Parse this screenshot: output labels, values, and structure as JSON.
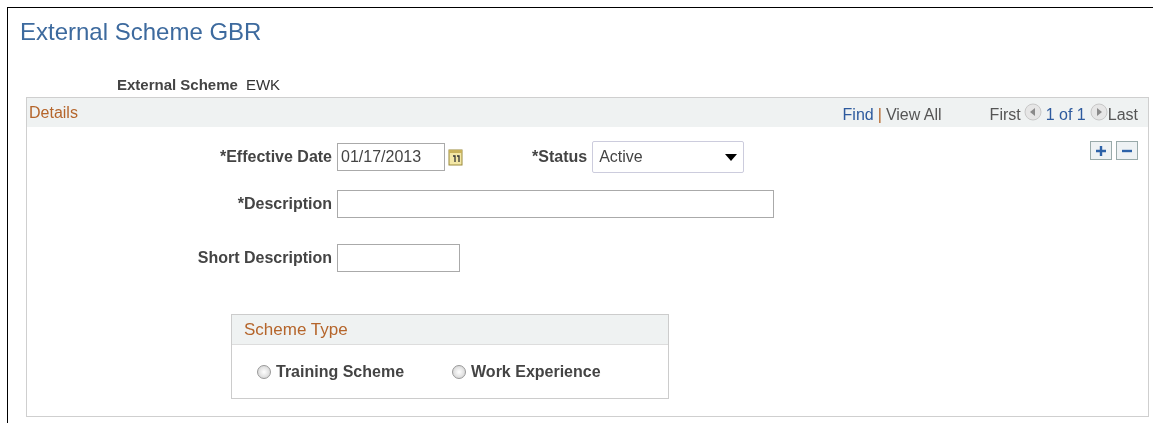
{
  "page_title": "External Scheme GBR",
  "key_field": {
    "label": "External Scheme",
    "value": "EWK"
  },
  "details": {
    "title": "Details",
    "nav": {
      "find": "Find",
      "separator": "|",
      "view_all": "View All",
      "first": "First",
      "counter": "1 of 1",
      "last": "Last"
    },
    "effective_date": {
      "label": "*Effective Date",
      "value": "01/17/2013"
    },
    "status": {
      "label": "*Status",
      "value": "Active"
    },
    "description": {
      "label": "*Description"
    },
    "short_description": {
      "label": "Short Description"
    },
    "scheme_type": {
      "title": "Scheme Type",
      "options": [
        {
          "label": "Training Scheme",
          "selected": false
        },
        {
          "label": "Work Experience",
          "selected": false
        }
      ]
    }
  }
}
